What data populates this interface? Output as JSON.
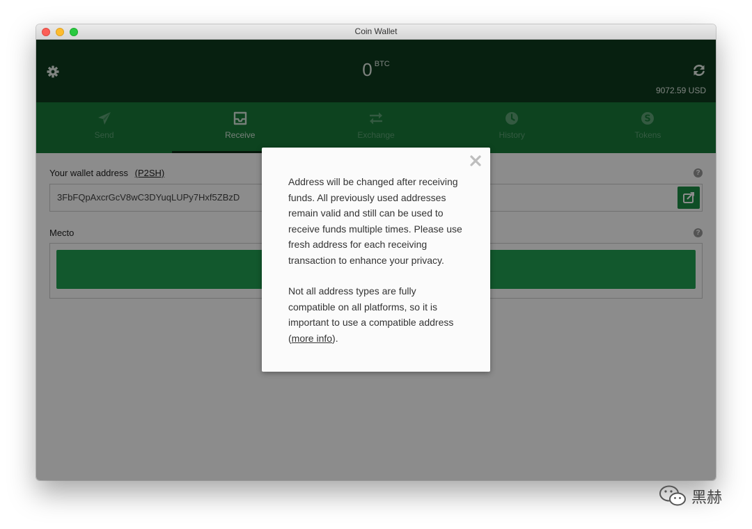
{
  "window": {
    "title": "Coin Wallet"
  },
  "header": {
    "balance_amount": "0",
    "balance_unit": "BTC",
    "fiat_value": "9072.59 USD"
  },
  "tabs": [
    {
      "label": "Send",
      "icon": "send-icon"
    },
    {
      "label": "Receive",
      "icon": "inbox-icon"
    },
    {
      "label": "Exchange",
      "icon": "exchange-icon"
    },
    {
      "label": "History",
      "icon": "clock-icon"
    },
    {
      "label": "Tokens",
      "icon": "token-icon"
    }
  ],
  "receive": {
    "address_label": "Your wallet address",
    "address_type": "(P2SH)",
    "address_value": "3FbFQpAxcrGcV8wC3DYuqLUPy7Hxf5ZBzD",
    "memo_label": "Mecto",
    "help_glyph": "?"
  },
  "modal": {
    "paragraph1": "Address will be changed after receiving funds. All previously used addresses remain valid and still can be used to receive funds multiple times. Please use fresh address for each receiving transaction to enhance your privacy.",
    "paragraph2_prefix": "Not all address types are fully compatible on all platforms, so it is important to use a compatible address (",
    "more_info_link": "more info",
    "paragraph2_suffix": ")."
  },
  "watermark": {
    "text": "黑赫"
  },
  "colors": {
    "header_bg": "#0d3b1e",
    "tabs_bg": "#187a3a",
    "accent_green": "#22a152"
  }
}
